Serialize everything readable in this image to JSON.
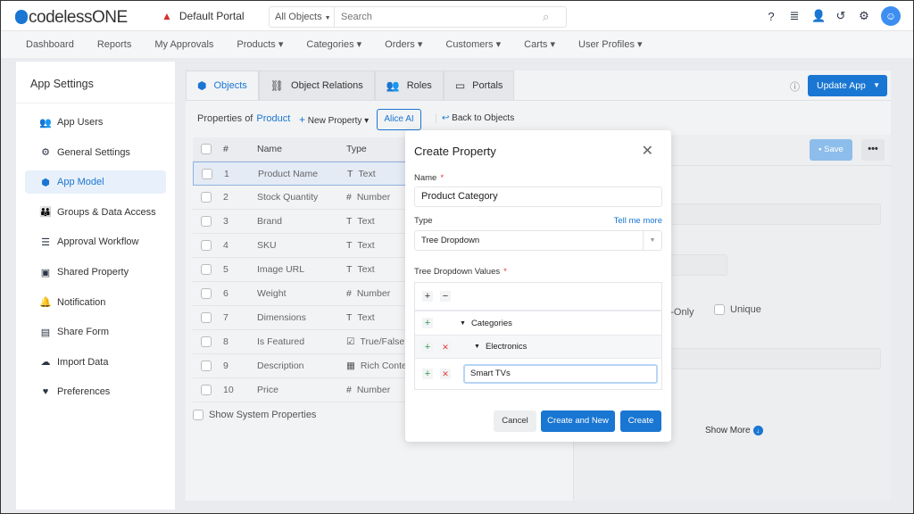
{
  "header": {
    "logo_text": "codelessONE",
    "portal": "Default Portal",
    "search_scope": "All Objects",
    "search_placeholder": "Search",
    "icons": [
      "help-icon",
      "database-icon",
      "add-user-icon",
      "history-icon",
      "gear-icon",
      "user-avatar-icon"
    ]
  },
  "nav": [
    "Dashboard",
    "Reports",
    "My Approvals",
    "Products ▾",
    "Categories ▾",
    "Orders ▾",
    "Customers ▾",
    "Carts ▾",
    "User Profiles ▾"
  ],
  "sidebar": {
    "title": "App Settings",
    "items": [
      {
        "label": "App Users",
        "icon": "users-icon",
        "glyph": "👥"
      },
      {
        "label": "General Settings",
        "icon": "gear-icon",
        "glyph": "⚙"
      },
      {
        "label": "App Model",
        "icon": "cube-icon",
        "glyph": "⬢",
        "active": true
      },
      {
        "label": "Groups & Data Access",
        "icon": "groups-icon",
        "glyph": "👪"
      },
      {
        "label": "Approval Workflow",
        "icon": "checklist-icon",
        "glyph": "☰"
      },
      {
        "label": "Shared Property",
        "icon": "archive-icon",
        "glyph": "▣"
      },
      {
        "label": "Notification",
        "icon": "bell-icon",
        "glyph": "🔔"
      },
      {
        "label": "Share Form",
        "icon": "form-icon",
        "glyph": "▤"
      },
      {
        "label": "Import Data",
        "icon": "cloud-upload-icon",
        "glyph": "☁"
      },
      {
        "label": "Preferences",
        "icon": "hand-heart-icon",
        "glyph": "♥"
      }
    ]
  },
  "tabs": [
    {
      "label": "Objects",
      "glyph": "⬢",
      "active": true
    },
    {
      "label": "Object Relations",
      "glyph": "⛓"
    },
    {
      "label": "Roles",
      "glyph": "👥"
    },
    {
      "label": "Portals",
      "glyph": "▭"
    }
  ],
  "update_app": "Update App",
  "toolbar": {
    "properties_of": "Properties of",
    "object": "Product",
    "new_property": "New Property ▾",
    "alice_ai": "Alice AI",
    "back": "Back to Objects"
  },
  "table": {
    "headers": [
      "#",
      "Name",
      "Type"
    ],
    "rows": [
      [
        "1",
        "Product Name",
        "T",
        "Text"
      ],
      [
        "2",
        "Stock Quantity",
        "#",
        "Number"
      ],
      [
        "3",
        "Brand",
        "T",
        "Text"
      ],
      [
        "4",
        "SKU",
        "T",
        "Text"
      ],
      [
        "5",
        "Image URL",
        "T",
        "Text"
      ],
      [
        "6",
        "Weight",
        "#",
        "Number"
      ],
      [
        "7",
        "Dimensions",
        "T",
        "Text"
      ],
      [
        "8",
        "Is Featured",
        "☑",
        "True/False"
      ],
      [
        "9",
        "Description",
        "▦",
        "Rich Content"
      ],
      [
        "10",
        "Price",
        "#",
        "Number"
      ]
    ],
    "show_system": "Show System Properties"
  },
  "right_panel": {
    "save": "Save",
    "more": "•••",
    "read_only": "ad-Only",
    "unique": "Unique",
    "show_more": "Show More"
  },
  "modal": {
    "title": "Create Property",
    "name_label": "Name",
    "name_value": "Product Category",
    "type_label": "Type",
    "tell_me_more": "Tell me more",
    "type_value": "Tree Dropdown",
    "tree_label": "Tree Dropdown Values",
    "tree": {
      "root": "Categories",
      "child": "Electronics",
      "editing": "Smart TVs"
    },
    "cancel": "Cancel",
    "create_and_new": "Create and New",
    "create": "Create"
  },
  "colors": {
    "accent": "#1976d2",
    "danger": "#e53935",
    "success": "#2e9d4f"
  }
}
